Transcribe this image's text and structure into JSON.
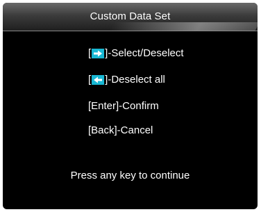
{
  "header": {
    "title": "Custom Data Set"
  },
  "instructions": [
    {
      "open_bracket": "[",
      "icon": "right-arrow-key-icon",
      "close_bracket": "]",
      "text": "-Select/Deselect"
    },
    {
      "open_bracket": "[",
      "icon": "left-arrow-key-icon",
      "close_bracket": "]",
      "text": "-Deselect all"
    },
    {
      "text": "[Enter]-Confirm"
    },
    {
      "text": "[Back]-Cancel"
    }
  ],
  "footer": {
    "message": "Press any key to continue"
  },
  "colors": {
    "screen_background": "#000000",
    "text": "#ffffff",
    "key_icon": "#19b8d4"
  }
}
